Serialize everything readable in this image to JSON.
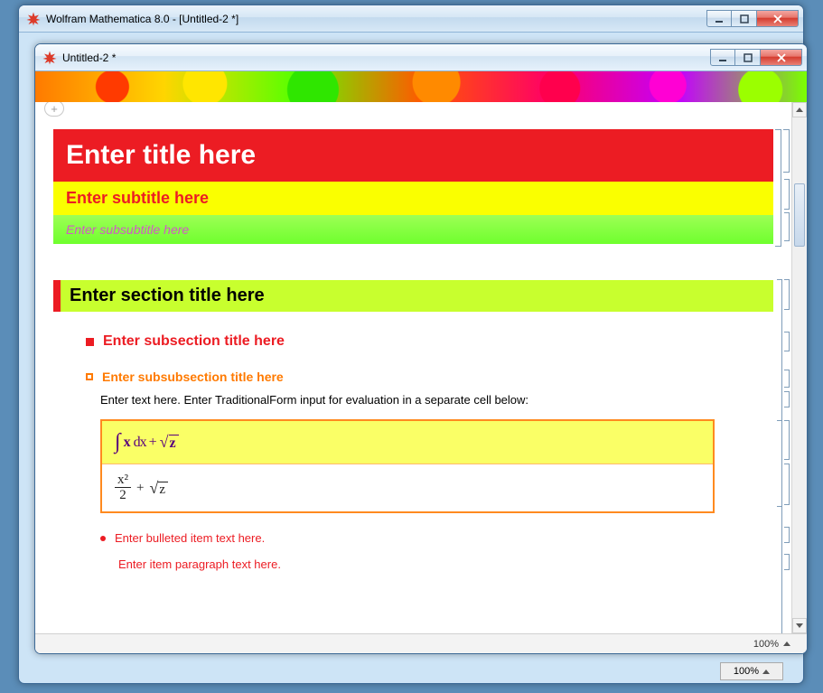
{
  "back_window": {
    "title": "Wolfram Mathematica 8.0 - [Untitled-2 *]",
    "status_zoom": "100%"
  },
  "front_window": {
    "title": "Untitled-2 *",
    "status_zoom": "100%"
  },
  "doc": {
    "title": "Enter title here",
    "subtitle": "Enter subtitle here",
    "subsubtitle": "Enter subsubtitle here",
    "section": "Enter section title here",
    "subsection": "Enter subsection title here",
    "subsubsection": "Enter subsubsection title here",
    "body_text": "Enter text here. Enter TraditionalForm input for evaluation in a separate cell below:",
    "formula_in_parts": {
      "int": "∫",
      "x1": "x",
      "dx": "dx",
      "plus": "+",
      "sqrt": "√",
      "z": "z"
    },
    "formula_out_parts": {
      "xsq": "x²",
      "two": "2",
      "plus": "+",
      "sqrt": "√",
      "z": "z"
    },
    "bullet": "Enter bulleted item text here.",
    "item_paragraph": "Enter item paragraph text here."
  }
}
